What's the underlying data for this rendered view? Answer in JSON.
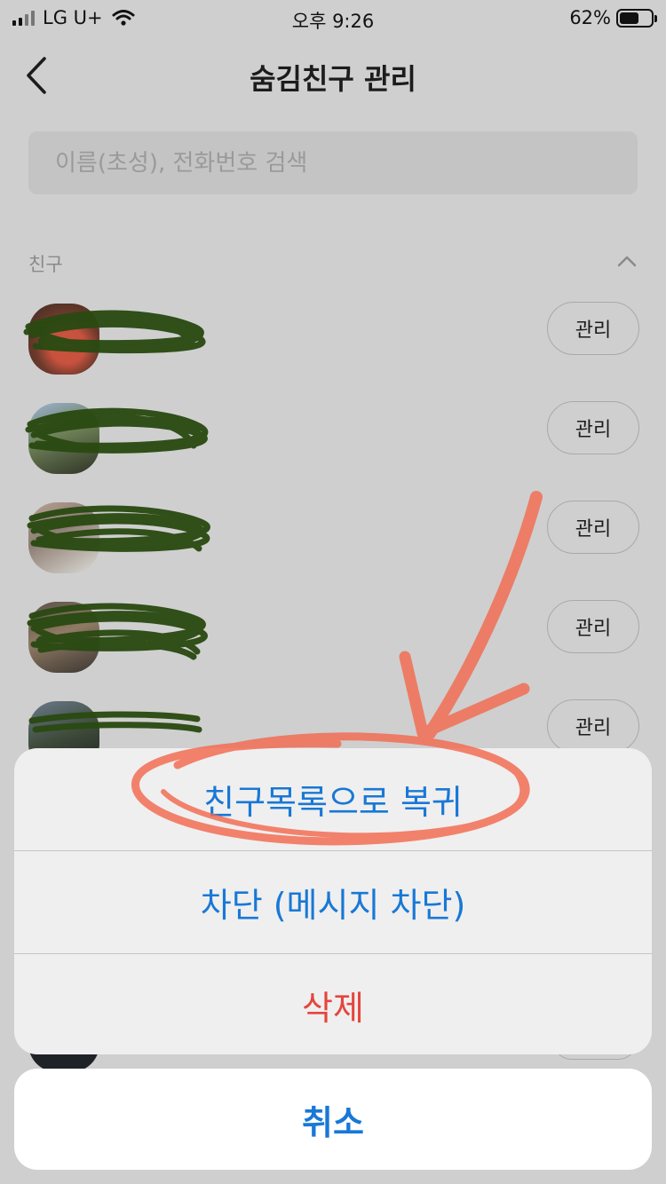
{
  "status_bar": {
    "carrier": "LG U+",
    "time": "오후 9:26",
    "battery": "62%",
    "battery_level": 0.62,
    "icons": [
      "signal-icon",
      "wifi-icon",
      "battery-icon"
    ]
  },
  "header": {
    "title": "숨김친구 관리",
    "back_icon": "chevron-left-icon"
  },
  "search": {
    "placeholder": "이름(초성), 전화번호 검색",
    "value": ""
  },
  "section": {
    "label": "친구",
    "collapse_icon": "chevron-up-icon"
  },
  "friends": [
    {
      "manage_label": "관리"
    },
    {
      "manage_label": "관리"
    },
    {
      "manage_label": "관리"
    },
    {
      "manage_label": "관리"
    },
    {
      "manage_label": "관리"
    }
  ],
  "action_sheet": {
    "restore_label": "친구목록으로 복귀",
    "block_label": "차단 (메시지 차단)",
    "delete_label": "삭제",
    "cancel_label": "취소"
  },
  "colors": {
    "accent": "#1878d6",
    "destructive": "#e5453d",
    "annotation": "#f36a4f",
    "redaction": "#2a4a12"
  }
}
